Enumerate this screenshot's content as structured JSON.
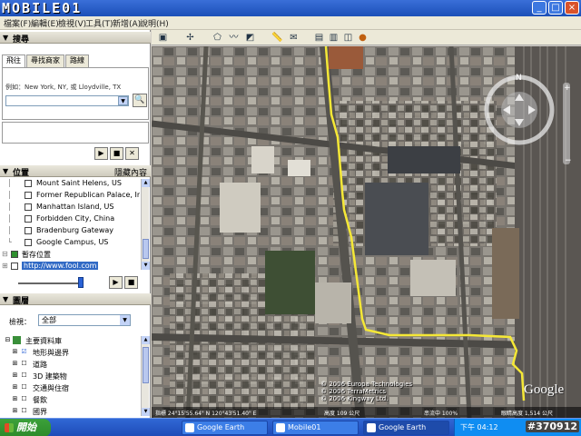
{
  "window": {
    "logo_text": "MOBILE01",
    "buttons": {
      "minimize": "_",
      "maximize": "□",
      "close": "×"
    }
  },
  "menu": {
    "items": [
      "檔案(F)",
      "編輯(E)",
      "檢視(V)",
      "工具(T)",
      "新增(A)",
      "說明(H)"
    ]
  },
  "search": {
    "header": "搜尋",
    "tabs": [
      "飛往",
      "尋找商家",
      "路線"
    ],
    "hint": "例如：New York, NY, 或 Lloydville, TX",
    "input_value": "",
    "go_icon": "search-icon"
  },
  "places": {
    "header": "位置",
    "header_right": "隱藏內容",
    "items": [
      "Mount Saint Helens, US",
      "Former Republican Palace, Ir",
      "Manhattan Island, US",
      "Forbidden City, China",
      "Bradenburg Gateway",
      "Google Campus, US"
    ],
    "folder_label": "暫存位置",
    "link": "http://www.fool.com"
  },
  "layers": {
    "header": "圖層",
    "view_label": "檢視：",
    "view_value": "全部",
    "items": [
      "主要資料庫",
      "地形與邊界",
      "道路",
      "3D 建築物",
      "交通與住宿",
      "餐飲",
      "國界"
    ]
  },
  "map": {
    "copyright_lines": [
      "© 2006 Europa Technologies",
      "© 2006 TerraMetrics",
      "© 2006 Kingway Ltd."
    ],
    "google_logo": "Google",
    "status_left": "指標 24°15'55.64\" N  120°43'51.40\" E",
    "status_mid": "高度 109 公尺",
    "status_right": "串流中 100%",
    "eye_alt": "眼睛高度 1,514 公尺"
  },
  "taskbar": {
    "start_label": "開始",
    "items": [
      "Google Earth",
      "Mobile01",
      "Google Earth"
    ],
    "clock": "下午 04:12",
    "watermark": "#370912"
  }
}
